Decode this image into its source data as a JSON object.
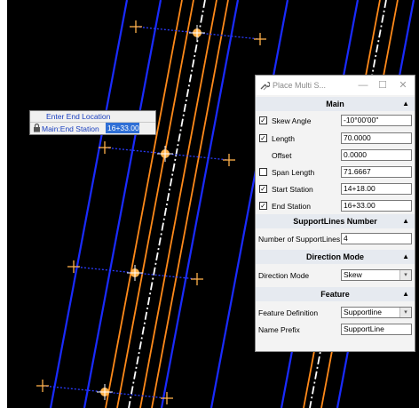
{
  "prompt": {
    "title": "Enter End Location",
    "field_label": "Main:End Station",
    "field_value": "16+33.00"
  },
  "dialog": {
    "title": "Place Multi S...",
    "minimize_glyph": "—",
    "maximize_glyph": "☐",
    "close_glyph": "✕",
    "sections": {
      "main": {
        "label": "Main",
        "rows": {
          "skew_angle": {
            "label": "Skew Angle",
            "value": "-10°00'00\"",
            "checked": true
          },
          "length": {
            "label": "Length",
            "value": "70.0000",
            "checked": true
          },
          "offset": {
            "label": "Offset",
            "value": "0.0000"
          },
          "span_length": {
            "label": "Span Length",
            "value": "71.6667",
            "checked": false
          },
          "start_station": {
            "label": "Start Station",
            "value": "14+18.00",
            "checked": true
          },
          "end_station": {
            "label": "End Station",
            "value": "16+33.00",
            "checked": true
          }
        }
      },
      "support_lines": {
        "label": "SupportLines Number",
        "rows": {
          "number": {
            "label": "Number of SupportLines",
            "value": "4"
          }
        }
      },
      "direction": {
        "label": "Direction Mode",
        "rows": {
          "mode": {
            "label": "Direction Mode",
            "value": "Skew"
          }
        }
      },
      "feature": {
        "label": "Feature",
        "rows": {
          "definition": {
            "label": "Feature Definition",
            "value": "Supportline"
          },
          "prefix": {
            "label": "Name Prefix",
            "value": "SupportLine"
          }
        }
      }
    }
  },
  "icons": {
    "check": "✓",
    "collapse": "▲",
    "dropdown": "▾"
  },
  "colors": {
    "background": "#000000",
    "blue_line": "#1a2bff",
    "orange_line": "#ff8a1a",
    "centerline": "#ffffff",
    "support_line": "#2a3cff",
    "marker": "#ffb14a",
    "prompt_highlight": "#2f6fd6"
  }
}
